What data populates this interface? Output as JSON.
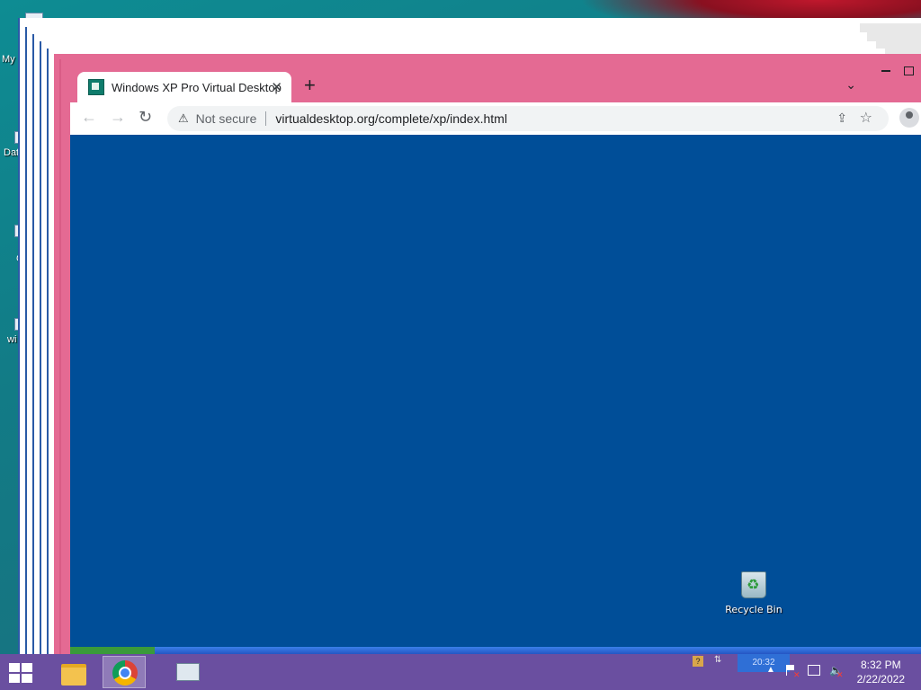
{
  "host_desktop": {
    "icons": [
      {
        "label": "My"
      },
      {
        "label": "Dat"
      },
      {
        "label": "C"
      },
      {
        "label": "wi"
      }
    ]
  },
  "browser": {
    "tab": {
      "title": "Windows XP Pro Virtual Desktop",
      "close": "✕"
    },
    "new_tab": "+",
    "tab_search": "⌄",
    "toolbar": {
      "back": "←",
      "forward": "→",
      "reload": "↻",
      "warning_icon": "⚠",
      "security_text": "Not secure",
      "url": "virtualdesktop.org/complete/xp/index.html",
      "share": "⇪",
      "bookmark": "☆"
    }
  },
  "xp_desktop": {
    "background_color": "#004e98",
    "icons": [
      {
        "label": "Recycle Bin"
      }
    ],
    "tray_time": "20:32",
    "help_glyph": "?",
    "dock_glyph": "⇅"
  },
  "taskbar": {
    "background_color": "#6a4fa0",
    "apps": [
      {
        "name": "File Explorer",
        "icon": "folder-icon"
      },
      {
        "name": "Google Chrome",
        "icon": "chrome-icon",
        "active": true
      },
      {
        "name": "Task Manager",
        "icon": "monitor-icon"
      }
    ],
    "tray_arrow": "▲",
    "volume_glyph": "🔈",
    "mute_mark": "✕",
    "clock": {
      "time": "8:32 PM",
      "date": "2/22/2022"
    }
  }
}
